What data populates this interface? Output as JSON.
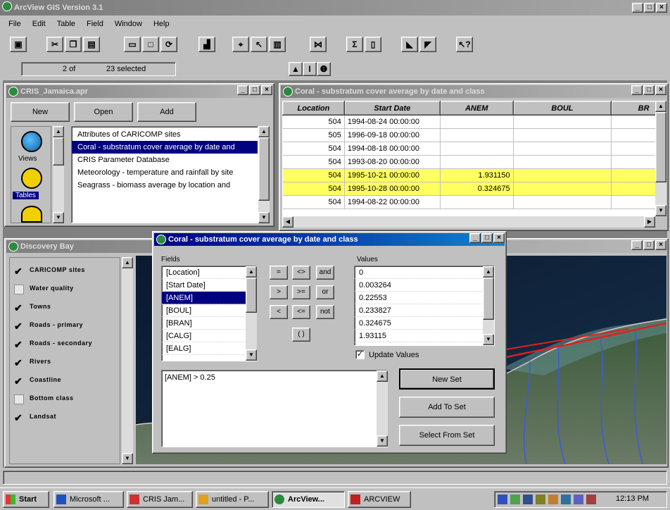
{
  "app": {
    "title": "ArcView GIS Version 3.1",
    "menu": [
      "File",
      "Edit",
      "Table",
      "Field",
      "Window",
      "Help"
    ]
  },
  "status": {
    "count": "2 of",
    "selected": "23 selected"
  },
  "project_window": {
    "title": "CRIS_Jamaica.apr",
    "buttons": {
      "new": "New",
      "open": "Open",
      "add": "Add"
    },
    "categories": [
      "Views",
      "Tables"
    ],
    "items": [
      "Attributes of CARICOMP sites",
      "Coral - substratum cover average by date and",
      "CRIS Parameter Database",
      "Meteorology - temperature and rainfall by site",
      "Seagrass - biomass average by location and"
    ]
  },
  "table_window": {
    "title": "Coral - substratum cover average by date and class",
    "columns": [
      "Location",
      "Start Date",
      "ANEM",
      "BOUL",
      "BR"
    ],
    "rows": [
      {
        "location": "504",
        "date": "1994-08-24 00:00:00",
        "anem": "",
        "highlight": false
      },
      {
        "location": "505",
        "date": "1996-09-18 00:00:00",
        "anem": "",
        "highlight": false
      },
      {
        "location": "504",
        "date": "1994-08-18 00:00:00",
        "anem": "",
        "highlight": false
      },
      {
        "location": "504",
        "date": "1993-08-20 00:00:00",
        "anem": "",
        "highlight": false
      },
      {
        "location": "504",
        "date": "1995-10-21 00:00:00",
        "anem": "1.931150",
        "highlight": true
      },
      {
        "location": "504",
        "date": "1995-10-28 00:00:00",
        "anem": "0.324675",
        "highlight": true
      },
      {
        "location": "504",
        "date": "1994-08-22 00:00:00",
        "anem": "",
        "highlight": false
      }
    ]
  },
  "discovery_window": {
    "title": "Discovery Bay",
    "layers": [
      {
        "label": "CARICOMP sites",
        "checked": true
      },
      {
        "label": "Water quality",
        "checked": false
      },
      {
        "label": "Towns",
        "checked": true
      },
      {
        "label": "Roads - primary",
        "checked": true
      },
      {
        "label": "Roads - secondary",
        "checked": true
      },
      {
        "label": "Rivers",
        "checked": true
      },
      {
        "label": "Coastline",
        "checked": true
      },
      {
        "label": "Bottom class",
        "checked": false
      },
      {
        "label": "Landsat",
        "checked": true
      }
    ]
  },
  "query_dialog": {
    "title": "Coral - substratum cover average by date and class",
    "fields_label": "Fields",
    "values_label": "Values",
    "fields": [
      "[Location]",
      "[Start Date]",
      "[ANEM]",
      "[BOUL]",
      "[BRAN]",
      "[CALG]",
      "[EALG]"
    ],
    "selected_field": "[ANEM]",
    "values": [
      "0",
      "0.003264",
      "0.22553",
      "0.233827",
      "0.324675",
      "1.93115"
    ],
    "operators": [
      "=",
      "<>",
      "and",
      ">",
      ">=",
      "or",
      "<",
      "<=",
      "not",
      "( )"
    ],
    "update_values_label": "Update Values",
    "expression": "[ANEM] > 0.25",
    "buttons": {
      "new_set": "New Set",
      "add_to_set": "Add To Set",
      "select_from_set": "Select From Set"
    }
  },
  "taskbar": {
    "start": "Start",
    "tasks": [
      "Microsoft ...",
      "CRIS Jam...",
      "untitled - P...",
      "ArcView...",
      "ARCVIEW"
    ],
    "time": "12:13 PM"
  },
  "colors": {
    "title_active": "#000080",
    "highlight_row": "#ffff60",
    "selection": "#000080"
  }
}
